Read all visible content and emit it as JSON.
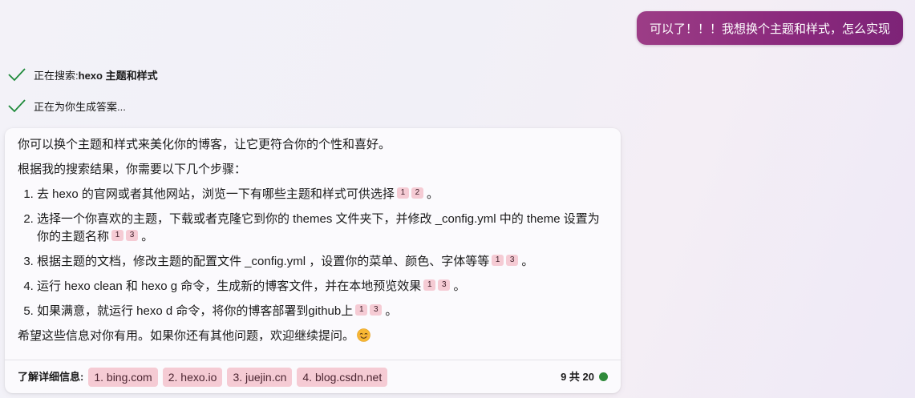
{
  "user_message": "可以了！！！我想换个主题和样式，怎么实现",
  "status": [
    {
      "prefix": "正在搜索: ",
      "query": "hexo 主题和样式"
    },
    {
      "prefix": "正在为你生成答案...",
      "query": ""
    }
  ],
  "answer": {
    "intro": "你可以换个主题和样式来美化你的博客，让它更符合你的个性和喜好。",
    "lead": "根据我的搜索结果，你需要以下几个步骤：",
    "steps": [
      {
        "text": "去 hexo 的官网或者其他网站，浏览一下有哪些主题和样式可供选择",
        "cites": [
          "1",
          "2"
        ],
        "tail": "。"
      },
      {
        "text": "选择一个你喜欢的主题，下载或者克隆它到你的 themes 文件夹下，并修改 _config.yml 中的 theme 设置为你的主题名称",
        "cites": [
          "1",
          "3"
        ],
        "tail": "。"
      },
      {
        "text": "根据主题的文档，修改主题的配置文件 _config.yml ，设置你的菜单、颜色、字体等等",
        "cites": [
          "1",
          "3"
        ],
        "tail": "。"
      },
      {
        "text": "运行 hexo clean 和 hexo g 命令，生成新的博客文件，并在本地预览效果",
        "cites": [
          "1",
          "3"
        ],
        "tail": "。"
      },
      {
        "text": "如果满意，就运行 hexo d 命令，将你的博客部署到github上",
        "cites": [
          "1",
          "3"
        ],
        "tail": "。"
      }
    ],
    "closing": "希望这些信息对你有用。如果你还有其他问题，欢迎继续提问。",
    "closing_icon": "smiling-face-emoji"
  },
  "learn_more": {
    "label": "了解详细信息:",
    "sources": [
      "1. bing.com",
      "2. hexo.io",
      "3. juejin.cn",
      "4. blog.csdn.net"
    ],
    "turn_count": "9 共 20"
  },
  "colors": {
    "user_bubble": "#8b2a7d",
    "citation_bg": "#f5cbd4",
    "check": "#1e8a3a",
    "status_dot": "#2f8a3a"
  }
}
